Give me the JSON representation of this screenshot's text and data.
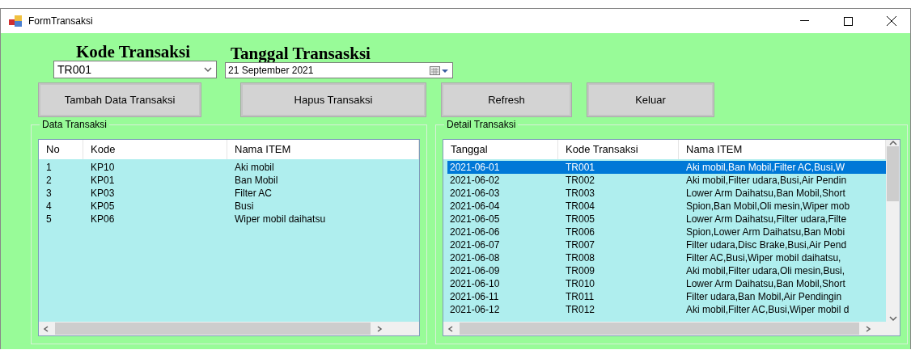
{
  "window": {
    "title": "FormTransaksi"
  },
  "kode_transaksi": {
    "label": "Kode Transaksi",
    "value": "TR001"
  },
  "tanggal_transaksi": {
    "label": "Tanggal Transasksi",
    "value": "21 September 2021"
  },
  "buttons": [
    "Tambah Data Transaksi",
    "Hapus Transaksi",
    "Refresh",
    "Keluar"
  ],
  "data_transaksi": {
    "title": "Data Transaksi",
    "columns": [
      "No",
      "Kode",
      "Nama ITEM"
    ],
    "rows": [
      [
        "1",
        "KP10",
        "Aki mobil"
      ],
      [
        "2",
        "KP01",
        "Ban Mobil"
      ],
      [
        "3",
        "KP03",
        "Filter AC"
      ],
      [
        "4",
        "KP05",
        "Busi"
      ],
      [
        "5",
        "KP06",
        "Wiper mobil daihatsu"
      ]
    ]
  },
  "detail_transaksi": {
    "title": "Detail Transaksi",
    "columns": [
      "Tanggal",
      "Kode Transaksi",
      "Nama ITEM"
    ],
    "rows": [
      {
        "cells": [
          "2021-06-01",
          "TR001",
          "Aki mobil,Ban Mobil,Filter AC,Busi,W"
        ],
        "selected": true
      },
      {
        "cells": [
          "2021-06-02",
          "TR002",
          "Aki mobil,Filter udara,Busi,Air Pendin"
        ],
        "selected": false
      },
      {
        "cells": [
          "2021-06-03",
          "TR003",
          "Lower Arm Daihatsu,Ban Mobil,Short"
        ],
        "selected": false
      },
      {
        "cells": [
          "2021-06-04",
          "TR004",
          "Spion,Ban Mobil,Oli mesin,Wiper mob"
        ],
        "selected": false
      },
      {
        "cells": [
          "2021-06-05",
          "TR005",
          "Lower Arm Daihatsu,Filter udara,Filte"
        ],
        "selected": false
      },
      {
        "cells": [
          "2021-06-06",
          "TR006",
          "Spion,Lower Arm Daihatsu,Ban Mobi"
        ],
        "selected": false
      },
      {
        "cells": [
          "2021-06-07",
          "TR007",
          "Filter udara,Disc Brake,Busi,Air Pend"
        ],
        "selected": false
      },
      {
        "cells": [
          "2021-06-08",
          "TR008",
          "Filter AC,Busi,Wiper mobil daihatsu,"
        ],
        "selected": false
      },
      {
        "cells": [
          "2021-06-09",
          "TR009",
          "Aki mobil,Filter udara,Oli mesin,Busi,"
        ],
        "selected": false
      },
      {
        "cells": [
          "2021-06-10",
          "TR010",
          "Lower Arm Daihatsu,Ban Mobil,Short"
        ],
        "selected": false
      },
      {
        "cells": [
          "2021-06-11",
          "TR011",
          "Filter udara,Ban Mobil,Air Pendingin"
        ],
        "selected": false
      },
      {
        "cells": [
          "2021-06-12",
          "TR012",
          "Aki mobil,Filter AC,Busi,Wiper mobil d"
        ],
        "selected": false
      }
    ]
  }
}
